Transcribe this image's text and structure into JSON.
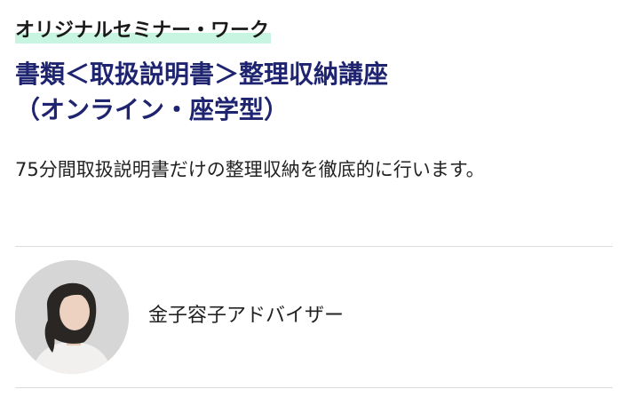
{
  "seminar": {
    "category": "オリジナルセミナー・ワーク",
    "title_line1": "書類＜取扱説明書＞整理収納講座",
    "title_line2": "（オンライン・座学型）",
    "description": "75分間取扱説明書だけの整理収納を徹底的に行います。"
  },
  "instructor": {
    "name": "金子容子アドバイザー",
    "avatar_icon": "person-photo"
  },
  "colors": {
    "title": "#1f2470",
    "category_highlight": "#c8f5e2",
    "divider": "#dcdcdc"
  }
}
